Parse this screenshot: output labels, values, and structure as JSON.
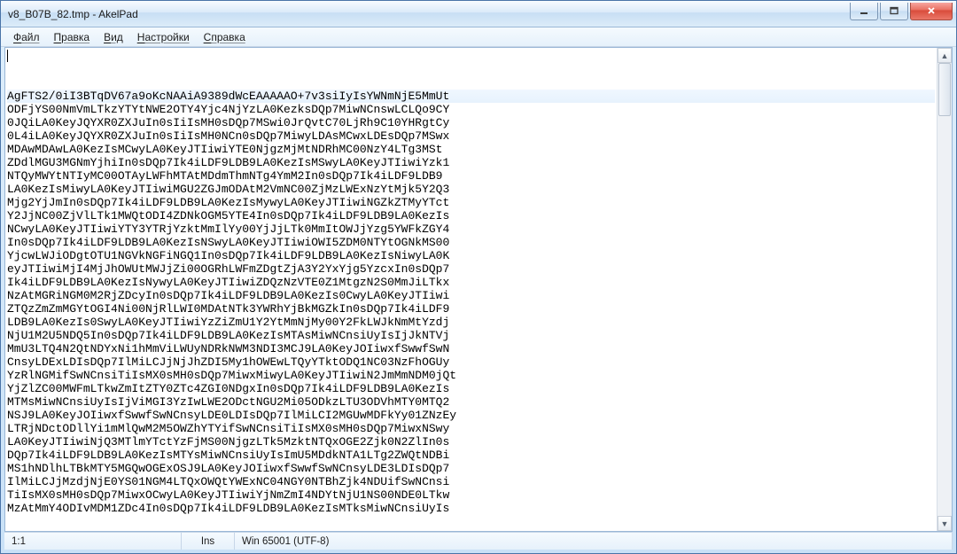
{
  "window": {
    "title": "v8_B07B_82.tmp - AkelPad"
  },
  "menu": {
    "file": "Файл",
    "edit": "Правка",
    "view": "Вид",
    "settings": "Настройки",
    "help": "Справка"
  },
  "editor": {
    "lines": [
      "AgFTS2/0iI3BTqDV67a9oKcNAAiA9389dWcEAAAAAO+7v3siIyIsYWNmNjE5MmUt",
      "ODFjYS00NmVmLTkzYTYtNWE2OTY4Yjc4NjYzLA0KezksDQp7MiwNCnswLCLQo9CY",
      "0JQiLA0KeyJQYXR0ZXJuIn0sIiIsMH0sDQp7MSwi0JrQvtC70LjRh9C10YHRgtCy",
      "0L4iLA0KeyJQYXR0ZXJuIn0sIiIsMH0NCn0sDQp7MiwyLDAsMCwxLDEsDQp7MSwx",
      "MDAwMDAwLA0KezIsMCwyLA0KeyJTIiwiYTE0NjgzMjMtNDRhMC00NzY4LTg3MSt",
      "ZDdlMGU3MGNmYjhiIn0sDQp7Ik4iLDF9LDB9LA0KezIsMSwyLA0KeyJTIiwiYzk1",
      "NTQyMWYtNTIyMC00OTAyLWFhMTAtMDdmThmNTg4YmM2In0sDQp7Ik4iLDF9LDB9",
      "LA0KezIsMiwyLA0KeyJTIiwiMGU2ZGJmODAtM2VmNC00ZjMzLWExNzYtMjk5Y2Q3",
      "Mjg2YjJmIn0sDQp7Ik4iLDF9LDB9LA0KezIsMywyLA0KeyJTIiwiNGZkZTMyYTct",
      "Y2JjNC00ZjVlLTk1MWQtODI4ZDNkOGM5YTE4In0sDQp7Ik4iLDF9LDB9LA0KezIs",
      "NCwyLA0KeyJTIiwiYTY3YTRjYzktMmIlYy00YjJjLTk0MmItOWJjYzg5YWFkZGY4",
      "In0sDQp7Ik4iLDF9LDB9LA0KezIsNSwyLA0KeyJTIiwiOWI5ZDM0NTYtOGNkMS00",
      "YjcwLWJiODgtOTU1NGVkNGFiNGQ1In0sDQp7Ik4iLDF9LDB9LA0KezIsNiwyLA0K",
      "eyJTIiwiMjI4MjJhOWUtMWJjZi00OGRhLWFmZDgtZjA3Y2YxYjg5YzcxIn0sDQp7",
      "Ik4iLDF9LDB9LA0KezIsNywyLA0KeyJTIiwiZDQzNzVTE0Z1MtgzN2S0MmJiLTkx",
      "NzAtMGRiNGM0M2RjZDcyIn0sDQp7Ik4iLDF9LDB9LA0KezIs0CwyLA0KeyJTIiwi",
      "ZTQzZmZmMGYtOGI4Ni00NjRlLWI0MDAtNTk3YWRhYjBkMGZkIn0sDQp7Ik4iLDF9",
      "LDB9LA0KezIs0SwyLA0KeyJTIiwiYzZiZmU1Y2YtMmNjMy00Y2FkLWJkNmMtYzdj",
      "NjU1M2U5NDQ5In0sDQp7Ik4iLDF9LDB9LA0KezIsMTAsMiwNCnsiUyIsIjJkNTVj",
      "MmU3LTQ4N2QtNDYxNi1hMmViLWUyNDRkNWM3NDI3MCJ9LA0KeyJOIiwxfSwwfSwN",
      "CnsyLDExLDIsDQp7IlMiLCJjNjJhZDI5My1hOWEwLTQyYTktODQ1NC03NzFhOGUy",
      "YzRlNGMifSwNCnsiTiIsMX0sMH0sDQp7MiwxMiwyLA0KeyJTIiwiN2JmMmNDM0jQt",
      "YjZlZC00MWFmLTkwZmItZTY0ZTc4ZGI0NDgxIn0sDQp7Ik4iLDF9LDB9LA0KezIs",
      "MTMsMiwNCnsiUyIsIjViMGI3YzIwLWE2ODctNGU2Mi05ODkzLTU3ODVhMTY0MTQ2",
      "NSJ9LA0KeyJOIiwxfSwwfSwNCnsyLDE0LDIsDQp7IlMiLCI2MGUwMDFkYy01ZNzEy",
      "LTRjNDctODllYi1mMlQwM2M5OWZhYTYifSwNCnsiTiIsMX0sMH0sDQp7MiwxNSwy",
      "LA0KeyJTIiwiNjQ3MTlmYTctYzFjMS00NjgzLTk5MzktNTQxOGE2Zjk0N2ZlIn0s",
      "DQp7Ik4iLDF9LDB9LA0KezIsMTYsMiwNCnsiUyIsImU5MDdkNTA1LTg2ZWQtNDBi",
      "MS1hNDlhLTBkMTY5MGQwOGExOSJ9LA0KeyJOIiwxfSwwfSwNCnsyLDE3LDIsDQp7",
      "IlMiLCJjMzdjNjE0YS01NGM4LTQxOWQtYWExNC04NGY0NTBhZjk4NDUifSwNCnsi",
      "TiIsMX0sMH0sDQp7MiwxOCwyLA0KeyJTIiwiYjNmZmI4NDYtNjU1NS00NDE0LTkw",
      "MzAtMmY4ODIvMDM1ZDc4In0sDQp7Ik4iLDF9LDB9LA0KezIsMTksMiwNCnsiUyIs"
    ]
  },
  "status": {
    "position": "1:1",
    "insert": "Ins",
    "encoding": "Win   65001 (UTF-8)"
  },
  "icons": {
    "minimize": "minimize-icon",
    "maximize": "maximize-icon",
    "close": "close-icon",
    "up": "▲",
    "down": "▼"
  }
}
